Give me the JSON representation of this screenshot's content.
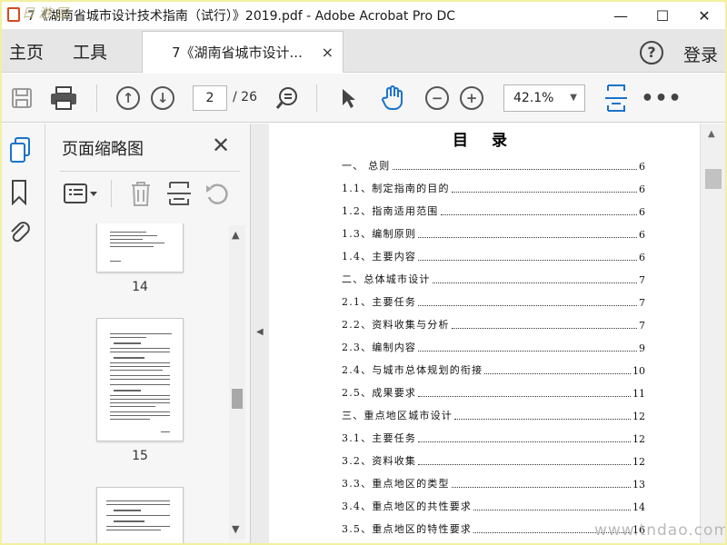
{
  "window": {
    "title": "7《湖南省城市设计技术指南（试行）》2019.pdf - Adobe Acrobat Pro DC",
    "title_watermark": "日 游 园",
    "controls": {
      "minimize": "—",
      "maximize": "☐",
      "close": "✕"
    }
  },
  "menu": {
    "home": "主页",
    "tools": "工具",
    "doc_tab": "7《湖南省城市设计...",
    "doc_tab_close": "×",
    "help": "?",
    "login": "登录"
  },
  "toolbar": {
    "page_current": "2",
    "page_total": "/ 26",
    "zoom": "42.1%",
    "more": "•••"
  },
  "thumbnails": {
    "title": "页面缩略图",
    "close": "✕",
    "pages": [
      "14",
      "15"
    ]
  },
  "document": {
    "toc_title": "目 录",
    "entries": [
      {
        "label": "一、  总则",
        "page": "6"
      },
      {
        "label": "1.1、制定指南的目的",
        "page": "6"
      },
      {
        "label": "1.2、指南适用范围",
        "page": "6"
      },
      {
        "label": "1.3、编制原则",
        "page": "6"
      },
      {
        "label": "1.4、主要内容",
        "page": "6"
      },
      {
        "label": "二、总体城市设计",
        "page": "7"
      },
      {
        "label": "2.1、主要任务",
        "page": "7"
      },
      {
        "label": "2.2、资料收集与分析",
        "page": "7"
      },
      {
        "label": "2.3、编制内容",
        "page": "9"
      },
      {
        "label": "2.4、与城市总体规划的衔接",
        "page": "10"
      },
      {
        "label": "2.5、成果要求",
        "page": "11"
      },
      {
        "label": "三、重点地区城市设计",
        "page": "12"
      },
      {
        "label": "3.1、主要任务",
        "page": "12"
      },
      {
        "label": "3.2、资料收集",
        "page": "12"
      },
      {
        "label": "3.3、重点地区的类型",
        "page": "13"
      },
      {
        "label": "3.4、重点地区的共性要求",
        "page": "14"
      },
      {
        "label": "3.5、重点地区的特性要求",
        "page": "16"
      }
    ]
  },
  "watermark": "www.tndao.com",
  "colors": {
    "accent_blue": "#1a73c9",
    "pdf_red": "#d64a1e",
    "frame_yellow": "#f2f0a0"
  }
}
